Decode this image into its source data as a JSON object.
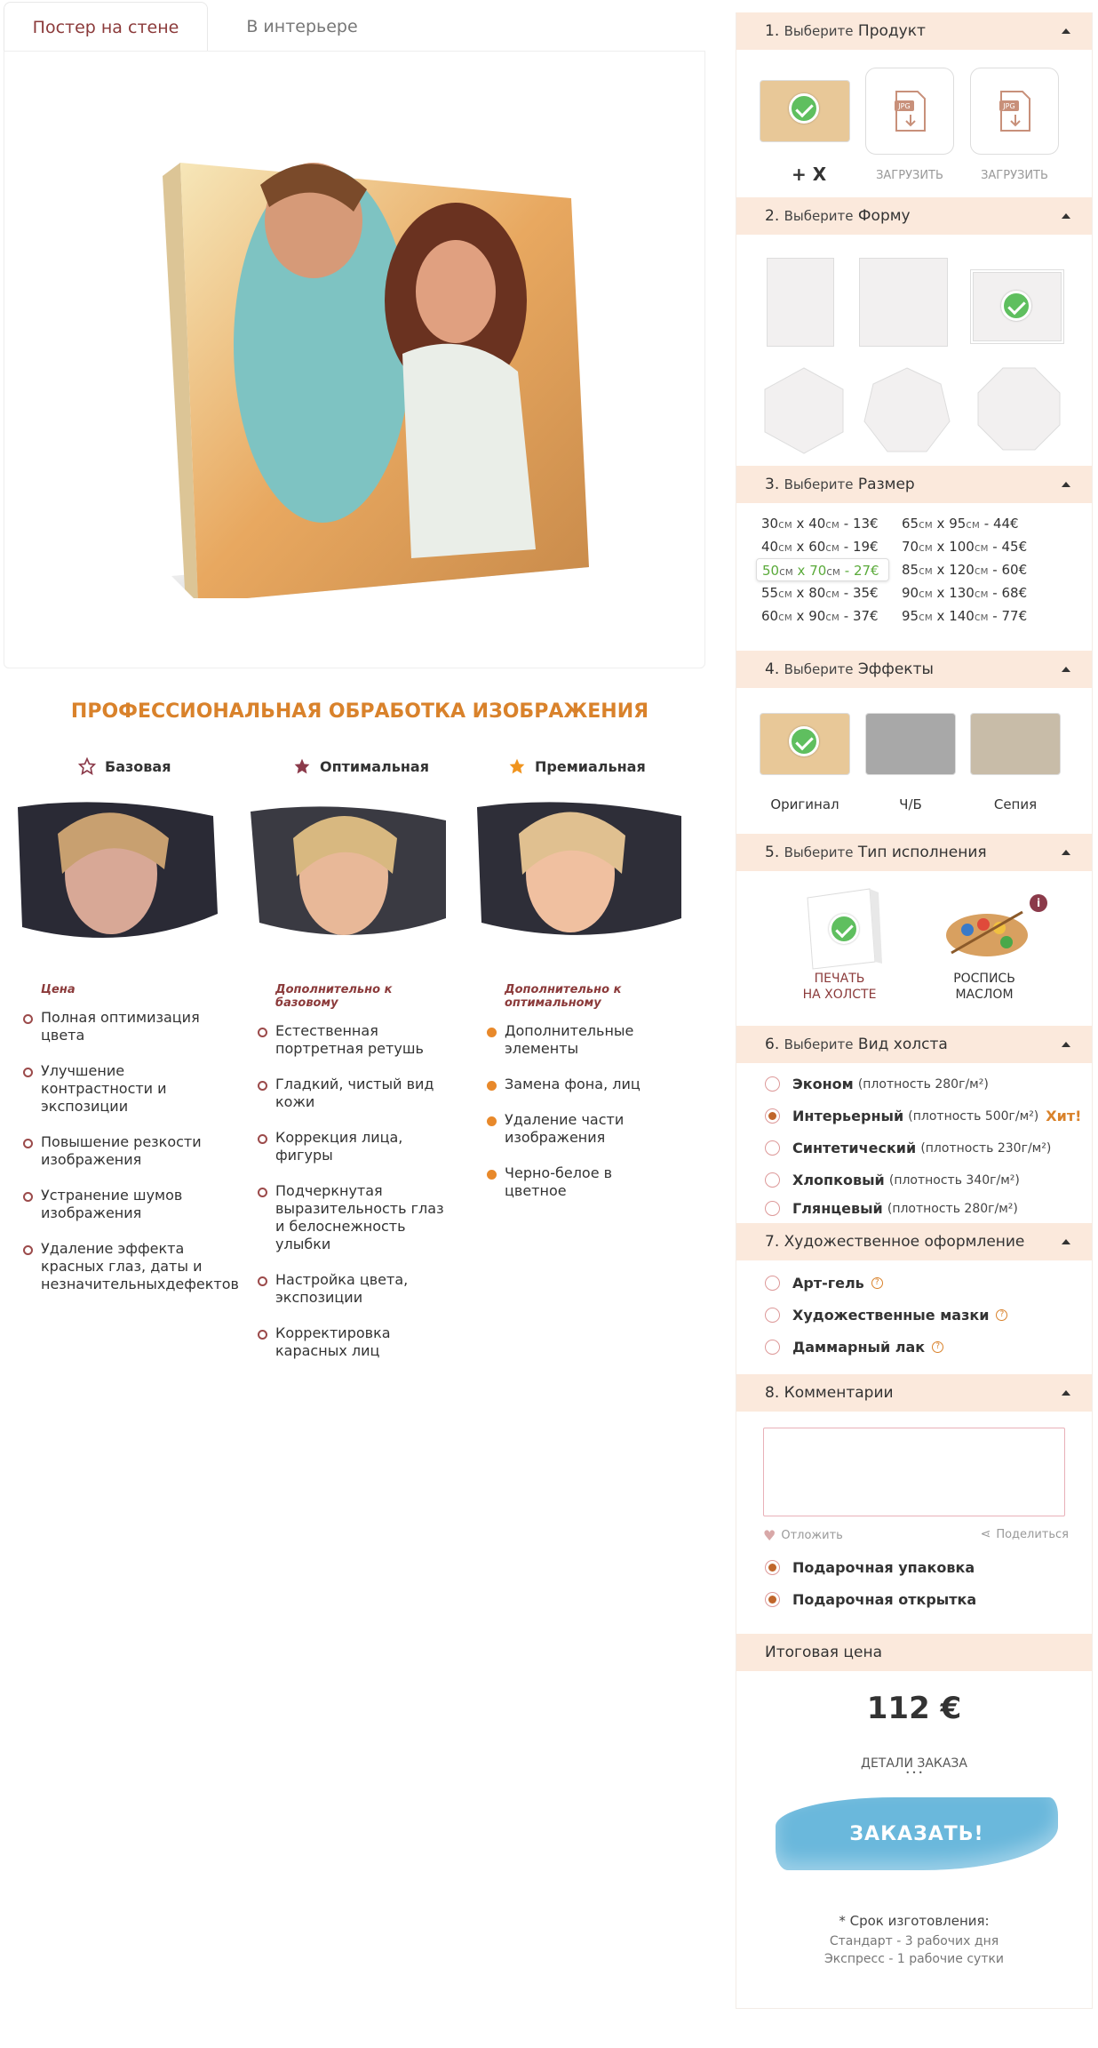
{
  "tabs": {
    "poster": "Постер на стене",
    "interior": "В интерьере"
  },
  "processing": {
    "title": "ПРОФЕССИОНАЛЬНАЯ ОБРАБОТКА ИЗОБРАЖЕНИЯ",
    "columns": [
      {
        "name": "Базовая",
        "sub": "Цена",
        "items": [
          "Полная оптимизация цвета",
          "Улучшение контрастности и экспозиции",
          "Повышение резкости изображения",
          "Устранение шумов изображения",
          "Удаление эффекта красных глаз, даты и незначительныхдефектов"
        ]
      },
      {
        "name": "Оптимальная",
        "sub": "Дополнительно к базовому",
        "items": [
          "Естественная портретная ретушь",
          "Гладкий, чистый вид кожи",
          "Коррекция лица, фигуры",
          "Подчеркнутая выразительность глаз и белоснежность улыбки",
          "Настройка цвета, экспозиции",
          "Корректировка карасных лиц"
        ]
      },
      {
        "name": "Премиальная",
        "sub": "Дополнительно к оптимальному",
        "items": [
          "Дополнительные элементы",
          "Замена фона, лиц",
          "Удаление части изображения",
          "Черно-белое в цветное"
        ]
      }
    ]
  },
  "sections": {
    "product": {
      "num": "1.",
      "pre": "Выберите",
      "title": "Продукт",
      "multiplier": "+ X",
      "upload1": "ЗАГРУЗИТЬ",
      "upload2": "ЗАГРУЗИТЬ",
      "file_type": "JPG"
    },
    "shape": {
      "num": "2.",
      "pre": "Выберите",
      "title": "Форму"
    },
    "size": {
      "num": "3.",
      "pre": "Выберите",
      "title": "Размер",
      "left": [
        {
          "w": "30",
          "h": "40",
          "price": "13"
        },
        {
          "w": "40",
          "h": "60",
          "price": "19"
        },
        {
          "w": "50",
          "h": "70",
          "price": "27"
        },
        {
          "w": "55",
          "h": "80",
          "price": "35"
        },
        {
          "w": "60",
          "h": "90",
          "price": "37"
        }
      ],
      "right": [
        {
          "w": "65",
          "h": "95",
          "price": "44"
        },
        {
          "w": "70",
          "h": "100",
          "price": "45"
        },
        {
          "w": "85",
          "h": "120",
          "price": "60"
        },
        {
          "w": "90",
          "h": "130",
          "price": "68"
        },
        {
          "w": "95",
          "h": "140",
          "price": "77"
        }
      ],
      "unit": "см",
      "x": "x",
      "dash": "-",
      "currency": "€"
    },
    "effects": {
      "num": "4.",
      "pre": "Выберите",
      "title": "Эффекты",
      "items": [
        "Оригинал",
        "Ч/Б",
        "Сепия"
      ]
    },
    "type": {
      "num": "5.",
      "pre": "Выберите",
      "title": "Тип исполнения",
      "canvas_line1": "ПЕЧАТЬ",
      "canvas_line2": "НА ХОЛСТЕ",
      "oil_line1": "РОСПИСЬ",
      "oil_line2": "МАСЛОМ",
      "info": "i"
    },
    "canvas_kind": {
      "num": "6.",
      "pre": "Выберите",
      "title": "Вид холста",
      "items": [
        {
          "name": "Эконом",
          "detail": "(плотность 280г/м²)"
        },
        {
          "name": "Интерьерный",
          "detail": "(плотность 500г/м²)",
          "badge": "Хит!"
        },
        {
          "name": "Синтетический",
          "detail": "(плотность 230г/м²)"
        },
        {
          "name": "Хлопковый",
          "detail": "(плотность 340г/м²)"
        },
        {
          "name": "Глянцевый",
          "detail": "(плотность 280г/м²)"
        }
      ]
    },
    "art": {
      "num": "7.",
      "title": "Художественное оформление",
      "items": [
        "Арт-гель",
        "Художественные мазки",
        "Даммарный лак"
      ],
      "help": "?"
    },
    "comments": {
      "num": "8.",
      "title": "Комментарии",
      "later": "Отложить",
      "share": "Поделиться",
      "gift_box": "Подарочная упаковка",
      "gift_card": "Подарочная открытка"
    },
    "total": {
      "title": "Итоговая цена",
      "price": "112 €",
      "details": "ДЕТАЛИ ЗАКАЗА",
      "dots": "• • •",
      "order": "ЗАКАЗАТЬ!",
      "lead_title": "* Срок изготовления:",
      "standard": "Стандарт - 3 рабочих дня",
      "express": "Экспресс - 1 рабочие сутки"
    }
  }
}
